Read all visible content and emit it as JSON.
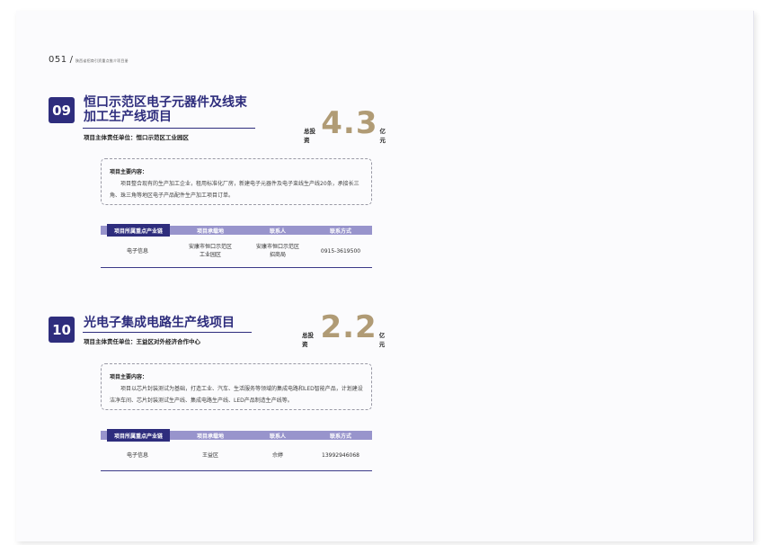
{
  "header": {
    "page_number": "051",
    "title": "陕西省招商引资重点推介项目册"
  },
  "projects": [
    {
      "number": "09",
      "title": "恒口示范区电子元器件及线束\n加工生产线项目",
      "responsible_label": "项目主体责任单位：",
      "responsible_unit": "恒口示范区工业园区",
      "investment_label": "总投资",
      "investment_value": "4.3",
      "investment_unit": "亿元",
      "content_heading": "项目主要内容：",
      "content_text": "项目整合现有的生产加工企业，租用标准化厂房，新建电子元器件及电子束线生产线20条，承接长三角、珠三角等地区电子产品配件生产加工项目订单。",
      "table": {
        "headers": [
          "项目所属重点产业链",
          "项目承载地",
          "联系人",
          "联系方式"
        ],
        "row": [
          "电子信息",
          "安康市恒口示范区\n工业园区",
          "安康市恒口示范区\n招商局",
          "0915-3619500"
        ]
      }
    },
    {
      "number": "10",
      "title": "光电子集成电路生产线项目",
      "responsible_label": "项目主体责任单位：",
      "responsible_unit": "王益区对外经济合作中心",
      "investment_label": "总投资",
      "investment_value": "2.2",
      "investment_unit": "亿元",
      "content_heading": "项目主要内容：",
      "content_text": "项目以芯片封装测试为基础，打造工业、汽车、生活服务等领域的集成电路和LED智能产品，计划建设洁净车间、芯片封装测试生产线、集成电路生产线、LED产品制造生产线等。",
      "table": {
        "headers": [
          "项目所属重点产业链",
          "项目承载地",
          "联系人",
          "联系方式"
        ],
        "row": [
          "电子信息",
          "王益区",
          "佘婷",
          "13992946068"
        ]
      }
    }
  ]
}
